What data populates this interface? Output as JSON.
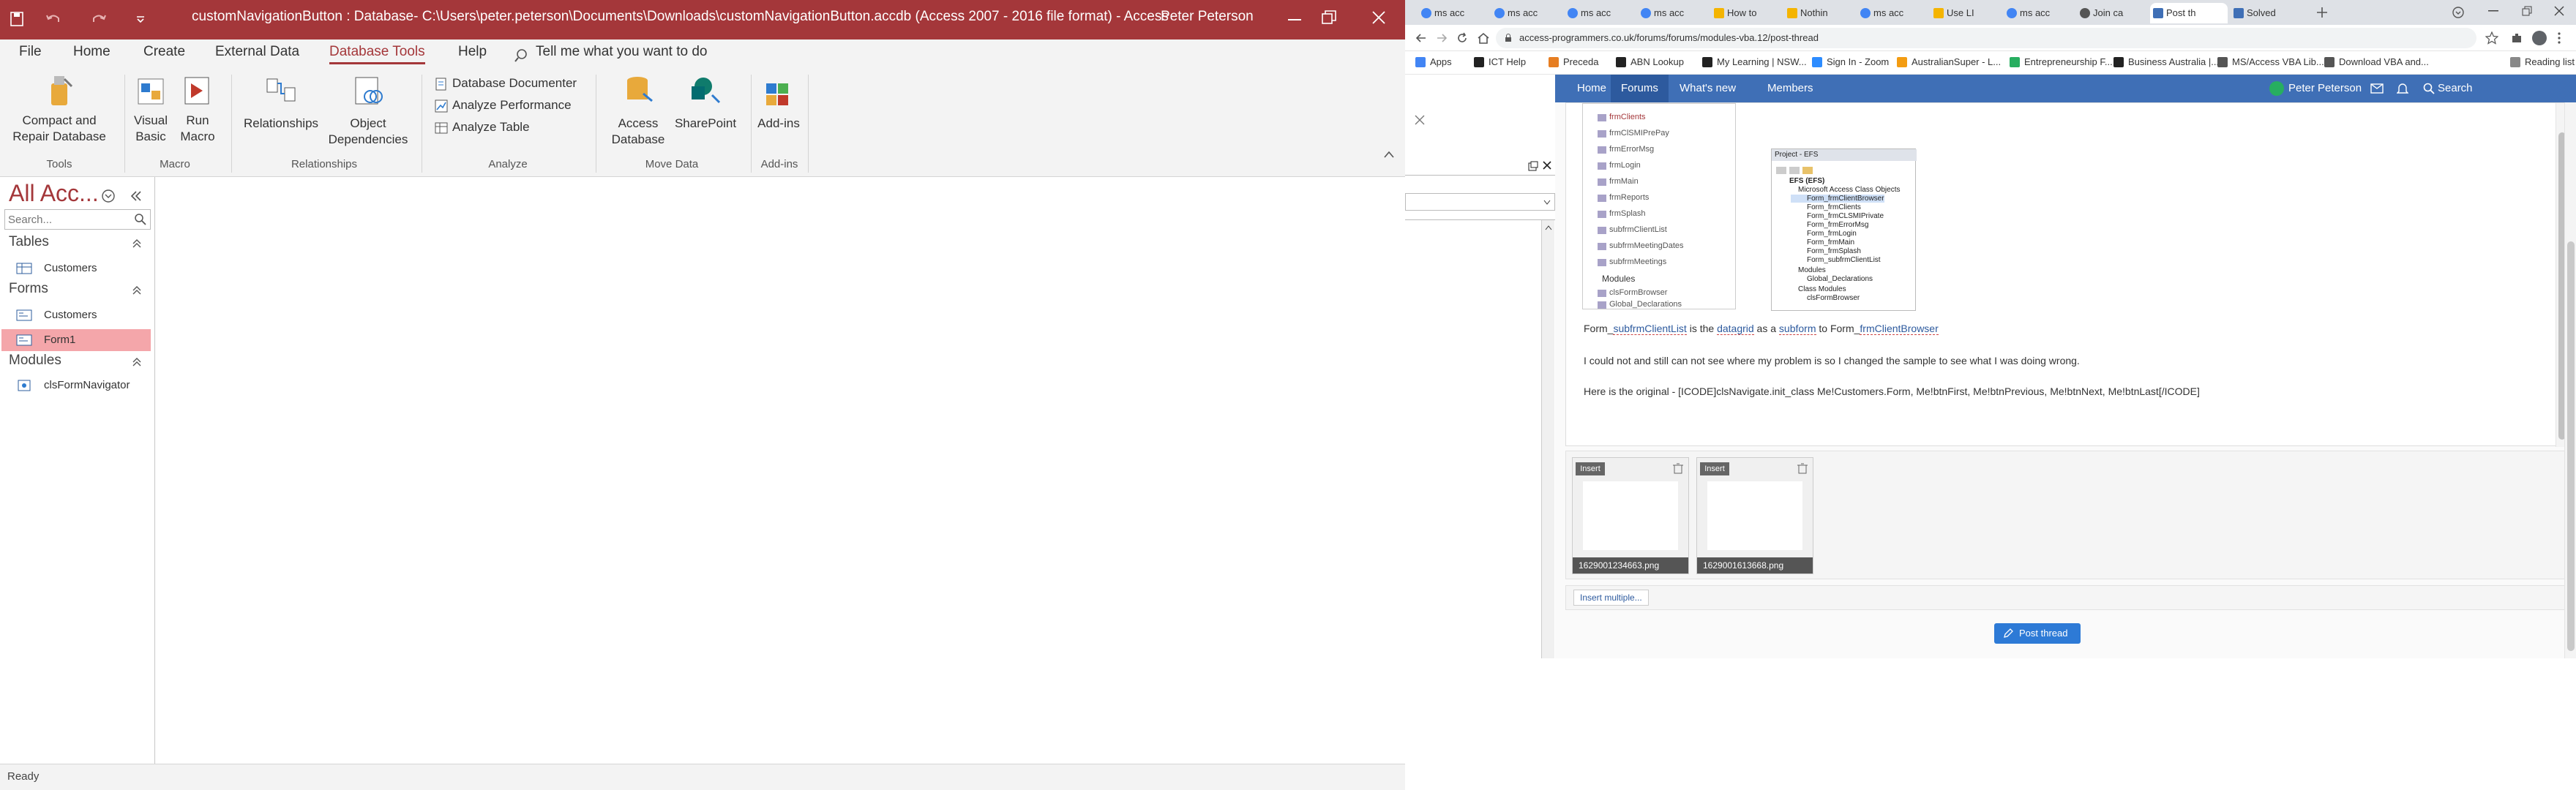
{
  "access": {
    "title": "customNavigationButton : Database- C:\\Users\\peter.peterson\\Documents\\Downloads\\customNavigationButton.accdb (Access 2007 - 2016 file format)  -  Access",
    "user": "Peter Peterson",
    "tabs": [
      "File",
      "Home",
      "Create",
      "External Data",
      "Database Tools",
      "Help"
    ],
    "active_tab": "Database Tools",
    "tell_me": "Tell me what you want to do",
    "ribbon": {
      "compact": "Compact and Repair Database",
      "visual_basic": "Visual Basic",
      "run_macro": "Run Macro",
      "relationships": "Relationships",
      "object_dependencies": "Object Dependencies",
      "database_documenter": "Database Documenter",
      "analyze_performance": "Analyze Performance",
      "analyze_table": "Analyze Table",
      "access_database": "Access Database",
      "sharepoint": "SharePoint",
      "add_ins": "Add-ins",
      "groups": [
        "Tools",
        "Macro",
        "Relationships",
        "Analyze",
        "Move Data",
        "Add-ins"
      ]
    },
    "nav": {
      "header": "All Acc...",
      "search_placeholder": "Search...",
      "sections": [
        {
          "name": "Tables",
          "items": [
            "Customers"
          ]
        },
        {
          "name": "Forms",
          "items": [
            "Customers",
            "Form1"
          ]
        },
        {
          "name": "Modules",
          "items": [
            "clsFormNavigator"
          ]
        }
      ],
      "selected": "Form1"
    },
    "status": "Ready"
  },
  "chrome": {
    "tabs": [
      "ms acc",
      "ms acc",
      "ms acc",
      "ms acc",
      "How to",
      "Nothin",
      "ms acc",
      "Use LI",
      "ms acc",
      "Join ca",
      "Post th",
      "Solved"
    ],
    "active_tab_index": 10,
    "url": "access-programmers.co.uk/forums/forums/modules-vba.12/post-thread",
    "bookmarks": [
      "Apps",
      "ICT Help",
      "Preceda",
      "ABN Lookup",
      "My Learning | NSW...",
      "Sign In - Zoom",
      "AustralianSuper - L...",
      "Entrepreneurship F...",
      "Business Australia |...",
      "MS/Access VBA Lib...",
      "Download VBA and...",
      "Reading list"
    ],
    "forum_nav": {
      "home": "Home",
      "forums": "Forums",
      "whats_new": "What's new",
      "members": "Members",
      "user": "Peter Peterson",
      "search": "Search"
    },
    "post": {
      "line1_prefix": "Form_",
      "line1_link1": "subfrmClientList",
      "line1_mid": " is the ",
      "line1_link2": "datagrid",
      "line1_mid2": " as a ",
      "line1_link3": "subform",
      "line1_mid3": " to Form_",
      "line1_link4": "frmClientBrowser",
      "line2": "I could not and still can not see where my problem is so I changed the sample to see what I was doing wrong.",
      "line3": "Here is the original - [ICODE]clsNavigate.init_class Me!Customers.Form, Me!btnFirst, Me!btnPrevious, Me!btnNext, Me!btnLast[/ICODE]"
    },
    "screenshot_left": [
      "frmClients",
      "frmClSMIPrePay",
      "frmErrorMsg",
      "frmLogin",
      "frmMain",
      "frmReports",
      "frmSplash",
      "subfrmClientList",
      "subfrmMeetingDates",
      "subfrmMeetings",
      "Modules",
      "clsFormBrowser",
      "Global_Declarations"
    ],
    "screenshot_project_title": "Project - EFS",
    "screenshot_project": [
      "EFS (EFS)",
      "Microsoft Access Class Objects",
      "Form_frmClientBrowser",
      "Form_frmClients",
      "Form_frmCLSMIPrivate",
      "Form_frmErrorMsg",
      "Form_frmLogin",
      "Form_frmMain",
      "Form_frmSplash",
      "Form_subfrmClientList",
      "Modules",
      "Global_Declarations",
      "Class Modules",
      "clsFormBrowser"
    ],
    "attachments": [
      {
        "label": "Insert",
        "name": "1629001234663.png"
      },
      {
        "label": "Insert",
        "name": "1629001613668.png"
      }
    ],
    "insert_multiple": "Insert multiple...",
    "post_thread": "Post thread"
  }
}
